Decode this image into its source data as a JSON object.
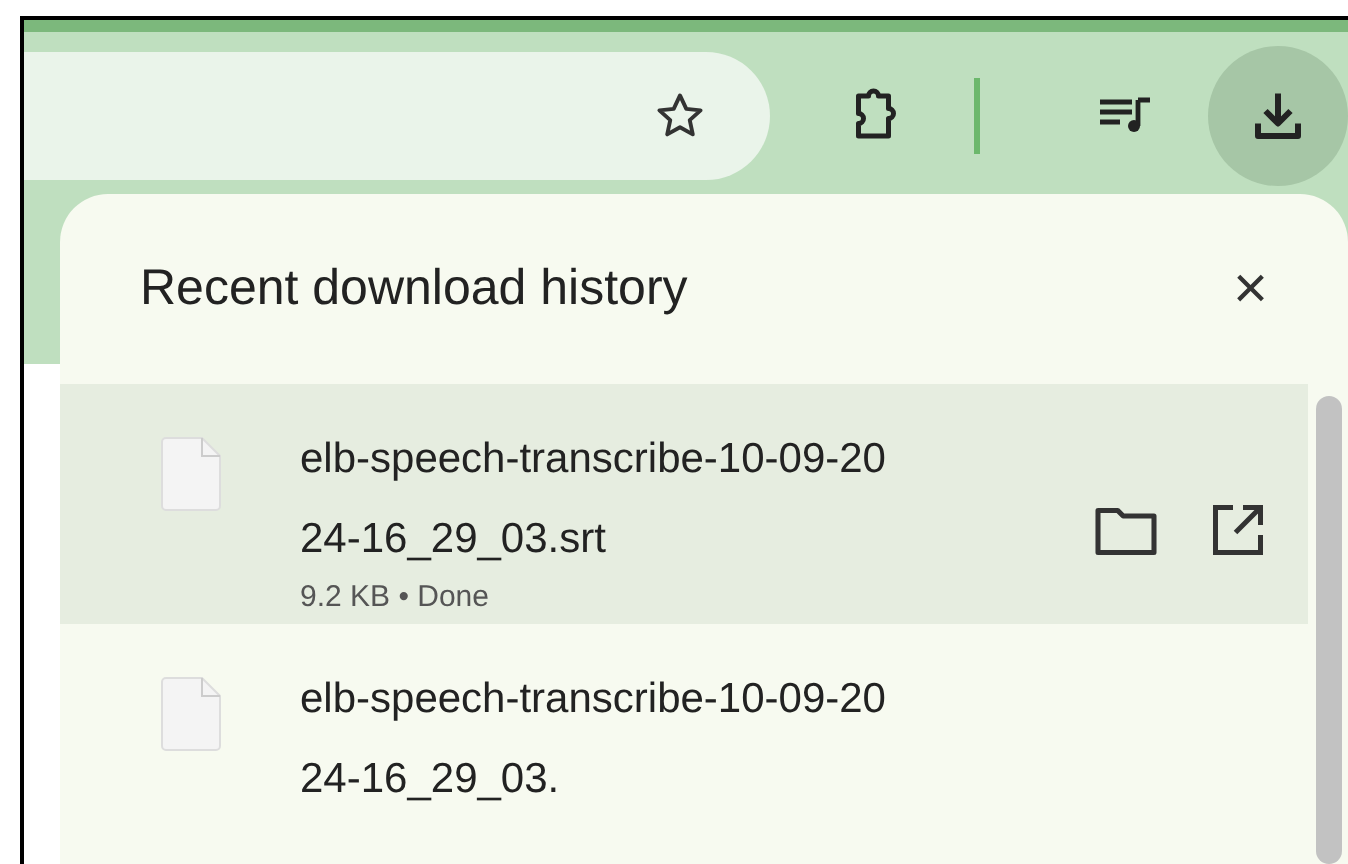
{
  "toolbar": {
    "buttons": [
      {
        "kind": "extensions",
        "selected": false
      },
      {
        "kind": "media",
        "selected": false
      },
      {
        "kind": "downloads",
        "selected": true
      }
    ]
  },
  "downloads_panel": {
    "title": "Recent download history",
    "close": "×",
    "items": [
      {
        "name": "elb-speech-transcribe-10-09-2024-16_29_03.srt",
        "status": "9.2 KB • Done",
        "selected": true
      },
      {
        "name": "elb-speech-transcribe-10-09-2024-16_29_03.",
        "selected": false
      }
    ]
  }
}
